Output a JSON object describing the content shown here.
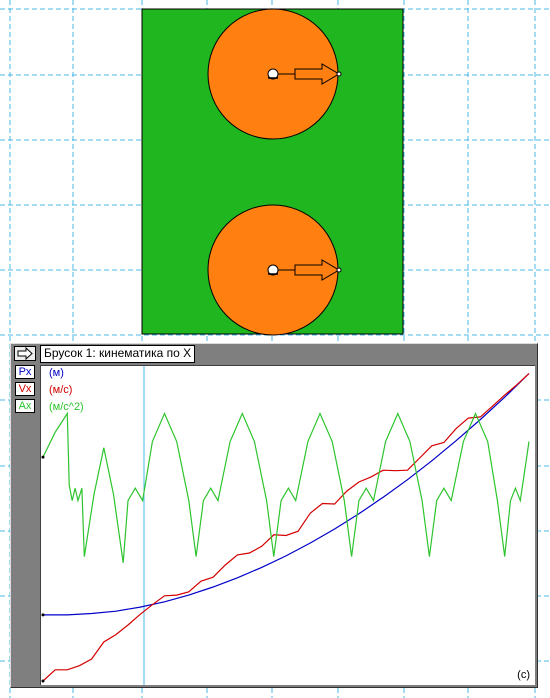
{
  "colors": {
    "grid": "#4ab8ea",
    "field": "#1fb61f",
    "wheel": "#ff7f10",
    "position": "#0000c8",
    "velocity": "#d40000",
    "acceleration": "#2ec42e"
  },
  "icons": {
    "graph_toggle": "arrow-right-icon",
    "wheel_axle": "axle-circle-icon",
    "velocity_vector": "vector-arrow-icon"
  },
  "graph": {
    "title": "Брусок 1: кинематика по X",
    "legend": [
      {
        "key": "Px",
        "unit": "(м)"
      },
      {
        "key": "Vx",
        "unit": "(м/с)"
      },
      {
        "key": "Ax",
        "unit": "(м/с^2)"
      }
    ],
    "x_unit": "(с)"
  },
  "chart_data": {
    "type": "line",
    "title": "Брусок 1: кинематика по X",
    "x_unit": "(с)",
    "grid": true,
    "legend_placement": "top-left",
    "series": [
      {
        "name": "Px",
        "unit": "(м)",
        "points": [
          [
            0.0,
            0.237
          ],
          [
            0.05,
            0.237
          ],
          [
            0.1,
            0.243
          ],
          [
            0.15,
            0.253
          ],
          [
            0.2,
            0.271
          ],
          [
            0.25,
            0.294
          ],
          [
            0.3,
            0.323
          ],
          [
            0.35,
            0.358
          ],
          [
            0.4,
            0.398
          ],
          [
            0.45,
            0.443
          ],
          [
            0.5,
            0.493
          ],
          [
            0.55,
            0.549
          ],
          [
            0.6,
            0.61
          ],
          [
            0.65,
            0.676
          ],
          [
            0.7,
            0.748
          ],
          [
            0.75,
            0.824
          ],
          [
            0.8,
            0.906
          ],
          [
            0.85,
            0.993
          ],
          [
            0.9,
            1.085
          ],
          [
            0.95,
            1.182
          ],
          [
            1.0,
            1.285
          ]
        ]
      },
      {
        "name": "Vx",
        "unit": "(м/с)",
        "points": [
          [
            0.0,
            0.0
          ],
          [
            0.025,
            0.047
          ],
          [
            0.05,
            0.047
          ],
          [
            0.075,
            0.064
          ],
          [
            0.1,
            0.092
          ],
          [
            0.125,
            0.163
          ],
          [
            0.15,
            0.194
          ],
          [
            0.175,
            0.234
          ],
          [
            0.2,
            0.279
          ],
          [
            0.225,
            0.319
          ],
          [
            0.25,
            0.356
          ],
          [
            0.275,
            0.359
          ],
          [
            0.3,
            0.373
          ],
          [
            0.325,
            0.417
          ],
          [
            0.35,
            0.434
          ],
          [
            0.375,
            0.485
          ],
          [
            0.4,
            0.527
          ],
          [
            0.425,
            0.535
          ],
          [
            0.45,
            0.563
          ],
          [
            0.475,
            0.611
          ],
          [
            0.5,
            0.608
          ],
          [
            0.525,
            0.626
          ],
          [
            0.55,
            0.702
          ],
          [
            0.575,
            0.742
          ],
          [
            0.6,
            0.74
          ],
          [
            0.625,
            0.794
          ],
          [
            0.65,
            0.832
          ],
          [
            0.675,
            0.853
          ],
          [
            0.7,
            0.881
          ],
          [
            0.725,
            0.879
          ],
          [
            0.75,
            0.881
          ],
          [
            0.775,
            0.932
          ],
          [
            0.8,
            0.983
          ],
          [
            0.825,
            0.997
          ],
          [
            0.85,
            1.055
          ],
          [
            0.875,
            1.099
          ],
          [
            0.9,
            1.104
          ],
          [
            0.925,
            1.149
          ],
          [
            0.95,
            1.195
          ],
          [
            0.975,
            1.238
          ],
          [
            1.0,
            1.285
          ]
        ]
      },
      {
        "name": "Ax",
        "unit": "(м/с^2)",
        "points": [
          [
            0.0,
            0.72
          ],
          [
            0.025,
            0.8
          ],
          [
            0.05,
            0.86
          ],
          [
            0.054,
            0.63
          ],
          [
            0.06,
            0.58
          ],
          [
            0.066,
            0.62
          ],
          [
            0.072,
            0.58
          ],
          [
            0.08,
            0.62
          ],
          [
            0.085,
            0.4
          ],
          [
            0.105,
            0.6
          ],
          [
            0.125,
            0.75
          ],
          [
            0.145,
            0.6
          ],
          [
            0.165,
            0.38
          ],
          [
            0.175,
            0.58
          ],
          [
            0.19,
            0.62
          ],
          [
            0.205,
            0.58
          ],
          [
            0.225,
            0.77
          ],
          [
            0.25,
            0.86
          ],
          [
            0.275,
            0.77
          ],
          [
            0.3,
            0.58
          ],
          [
            0.315,
            0.4
          ],
          [
            0.33,
            0.58
          ],
          [
            0.345,
            0.62
          ],
          [
            0.36,
            0.58
          ],
          [
            0.385,
            0.77
          ],
          [
            0.41,
            0.86
          ],
          [
            0.435,
            0.77
          ],
          [
            0.46,
            0.58
          ],
          [
            0.475,
            0.4
          ],
          [
            0.49,
            0.58
          ],
          [
            0.505,
            0.62
          ],
          [
            0.52,
            0.58
          ],
          [
            0.545,
            0.77
          ],
          [
            0.57,
            0.86
          ],
          [
            0.595,
            0.77
          ],
          [
            0.62,
            0.58
          ],
          [
            0.635,
            0.4
          ],
          [
            0.65,
            0.58
          ],
          [
            0.665,
            0.62
          ],
          [
            0.68,
            0.58
          ],
          [
            0.705,
            0.77
          ],
          [
            0.73,
            0.86
          ],
          [
            0.755,
            0.77
          ],
          [
            0.78,
            0.58
          ],
          [
            0.795,
            0.4
          ],
          [
            0.81,
            0.58
          ],
          [
            0.825,
            0.62
          ],
          [
            0.84,
            0.58
          ],
          [
            0.865,
            0.77
          ],
          [
            0.89,
            0.86
          ],
          [
            0.915,
            0.77
          ],
          [
            0.935,
            0.58
          ],
          [
            0.95,
            0.4
          ],
          [
            0.962,
            0.58
          ],
          [
            0.972,
            0.62
          ],
          [
            0.982,
            0.58
          ],
          [
            1.0,
            0.77
          ]
        ]
      }
    ]
  }
}
